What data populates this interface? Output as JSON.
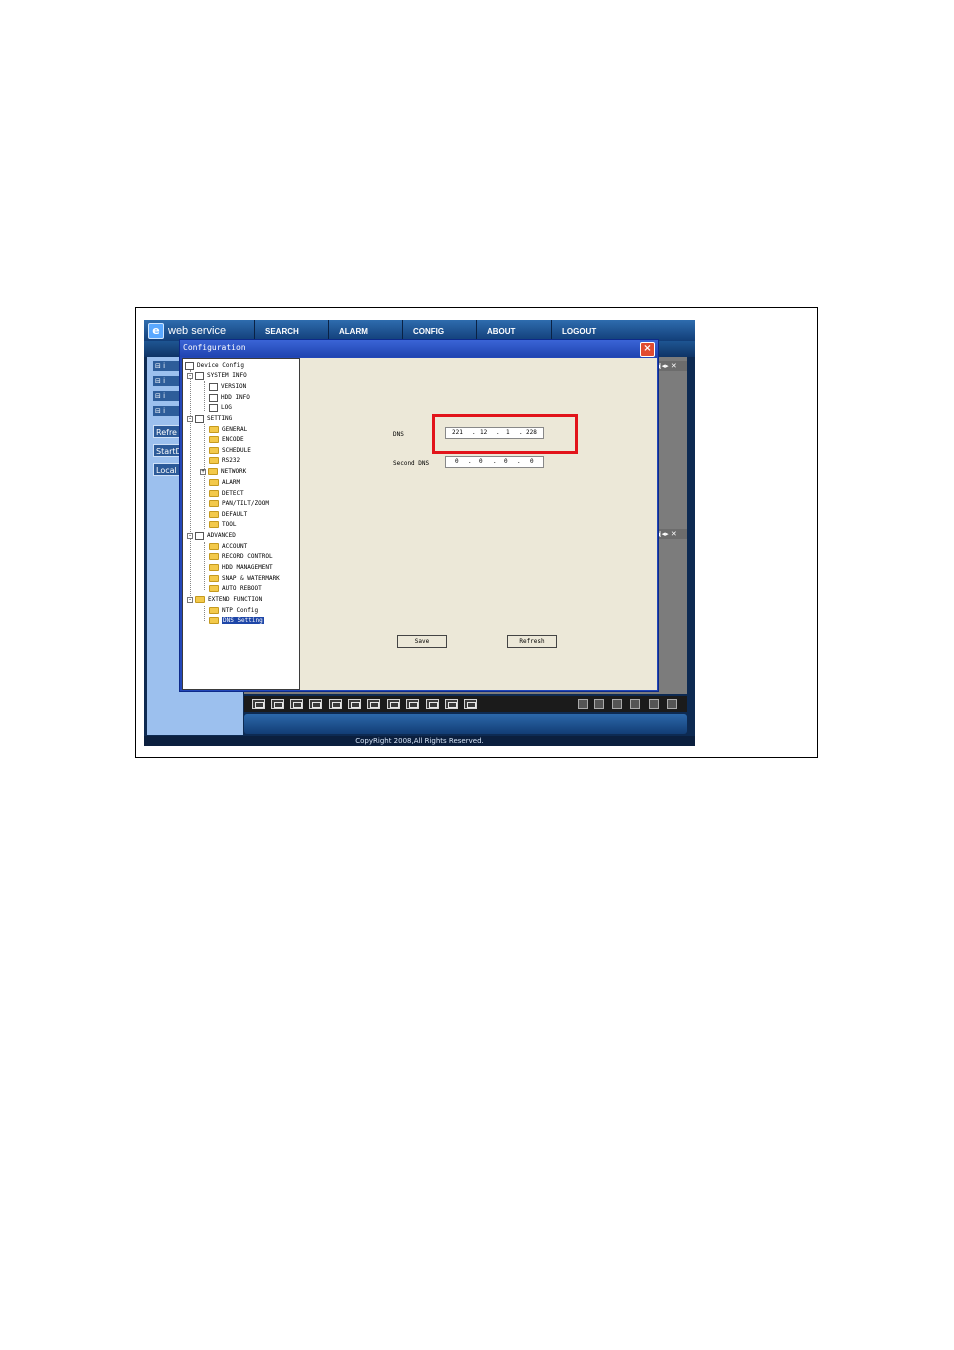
{
  "app": {
    "brand": "web service",
    "nav": [
      "SEARCH",
      "ALARM",
      "CONFIG",
      "ABOUT",
      "LOGOUT"
    ],
    "left_buttons": [
      "Refre",
      "StartDi",
      "Local F"
    ],
    "footer": "CopyRight 2008,All Rights Reserved."
  },
  "dialog": {
    "title": "Configuration",
    "close_glyph": "×",
    "tree": {
      "root": "Device Config",
      "system_info": "SYSTEM INFO",
      "system_info_items": [
        "VERSION",
        "HDD INFO",
        "LOG"
      ],
      "setting": "SETTING",
      "setting_items": [
        "GENERAL",
        "ENCODE",
        "SCHEDULE",
        "RS232",
        "NETWORK",
        "ALARM",
        "DETECT",
        "PAN/TILT/ZOOM",
        "DEFAULT",
        "TOOL"
      ],
      "advanced": "ADVANCED",
      "advanced_items": [
        "ACCOUNT",
        "RECORD CONTROL",
        "HDD MANAGEMENT",
        "SNAP & WATERMARK",
        "AUTO REBOOT"
      ],
      "extend": "EXTEND FUNCTION",
      "extend_items": [
        "NTP Config",
        "DNS Setting"
      ]
    },
    "form": {
      "dns_label": "DNS",
      "dns": [
        "221",
        "12",
        "1",
        "228"
      ],
      "second_dns_label": "Second DNS",
      "second_dns": [
        "0",
        "0",
        "0",
        "0"
      ],
      "save": "Save",
      "refresh": "Refresh"
    }
  },
  "colors": {
    "highlight": "#e2141b",
    "nav": "#1a4d8c",
    "dialog": "#2347b8"
  }
}
